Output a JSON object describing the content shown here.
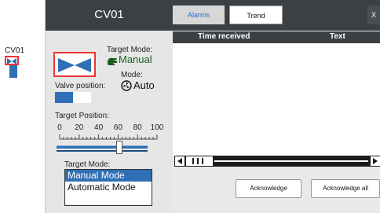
{
  "canvas": {
    "tag": "CV01"
  },
  "faceplate": {
    "title": "CV01",
    "target_mode_label": "Target Mode:",
    "target_mode_value": "Manual",
    "mode_label": "Mode:",
    "mode_value": "Auto",
    "valve_position_label": "Valve position:",
    "valve_position_fraction": 0.5,
    "target_position_label": "Target Position:",
    "scale_ticks": [
      "0",
      "20",
      "40",
      "60",
      "80",
      "100"
    ],
    "target_position_value": 60,
    "target_mode_list_label": "Target Mode:",
    "mode_options": [
      "Manual Mode",
      "Automatic Mode"
    ],
    "selected_mode_option": "Manual Mode"
  },
  "alarms_panel": {
    "tabs": [
      "Alarms",
      "Trend"
    ],
    "active_tab": "Alarms",
    "close_label": "X",
    "columns": [
      "Time received",
      "Text"
    ],
    "rows": [],
    "acknowledge_label": "Acknowledge",
    "acknowledge_all_label": "Acknowledge all"
  },
  "colors": {
    "accent": "#2f6fb6",
    "header": "#3c3f44",
    "highlight": "#e33333",
    "manual_icon": "#1b5e20"
  },
  "icons": [
    "valve-icon",
    "manual-hand-icon",
    "auto-fan-icon",
    "arrow-left-icon",
    "arrow-right-icon"
  ]
}
